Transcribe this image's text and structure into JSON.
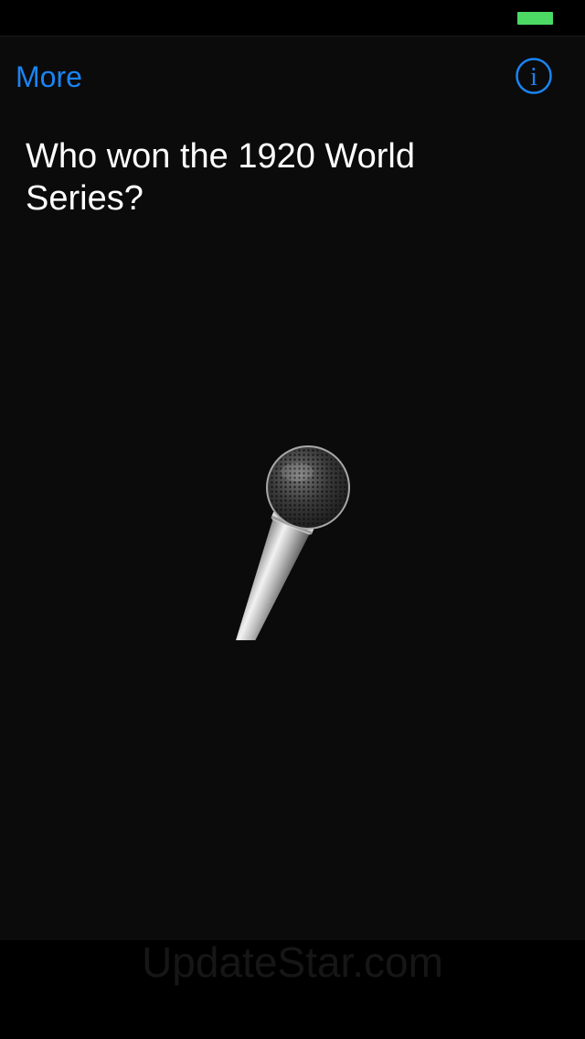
{
  "status_bar": {
    "battery_color": "#4cd964"
  },
  "nav": {
    "more_label": "More",
    "info_icon": "info-icon",
    "accent_color": "#1a84f4"
  },
  "question": {
    "text": "Who won the 1920 World Series?"
  },
  "microphone": {
    "icon": "microphone-icon"
  },
  "watermark": {
    "text": "UpdateStar.com"
  }
}
